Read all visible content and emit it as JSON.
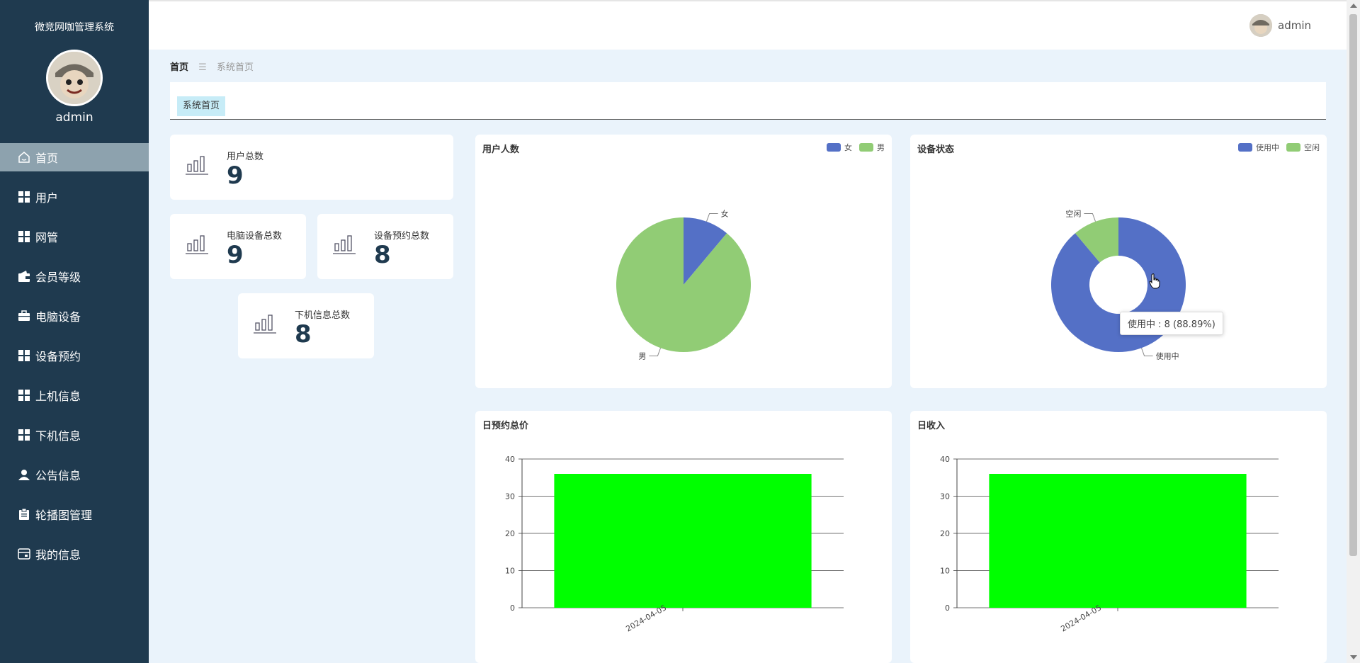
{
  "app": {
    "title": "微竞网咖管理系统",
    "username": "admin"
  },
  "sidebar": {
    "items": [
      {
        "label": "首页",
        "icon": "home-icon"
      },
      {
        "label": "用户",
        "icon": "grid-icon"
      },
      {
        "label": "网管",
        "icon": "grid-icon"
      },
      {
        "label": "会员等级",
        "icon": "wallet-icon"
      },
      {
        "label": "电脑设备",
        "icon": "briefcase-icon"
      },
      {
        "label": "设备预约",
        "icon": "grid-icon"
      },
      {
        "label": "上机信息",
        "icon": "grid-icon"
      },
      {
        "label": "下机信息",
        "icon": "grid-icon"
      },
      {
        "label": "公告信息",
        "icon": "person-icon"
      },
      {
        "label": "轮播图管理",
        "icon": "clipboard-icon"
      },
      {
        "label": "我的信息",
        "icon": "card-icon"
      }
    ]
  },
  "breadcrumb": {
    "home": "首页",
    "separator": "☰",
    "current": "系统首页"
  },
  "tabs": [
    {
      "label": "系统首页"
    }
  ],
  "stats": {
    "users": {
      "label": "用户总数",
      "value": "9"
    },
    "computers": {
      "label": "电脑设备总数",
      "value": "9"
    },
    "reservations": {
      "label": "设备预约总数",
      "value": "8"
    },
    "logouts": {
      "label": "下机信息总数",
      "value": "8"
    }
  },
  "colors": {
    "blue": "#5470c6",
    "green": "#91cc75",
    "bar": "#00ff00",
    "sidebar": "#1f3a4f"
  },
  "chart_data": [
    {
      "type": "pie",
      "title": "用户人数",
      "slices": [
        {
          "name": "女",
          "value": 1
        },
        {
          "name": "男",
          "value": 8
        }
      ]
    },
    {
      "type": "pie",
      "variant": "donut",
      "title": "设备状态",
      "slices": [
        {
          "name": "使用中",
          "value": 8
        },
        {
          "name": "空闲",
          "value": 1
        }
      ],
      "tooltip": "使用中 : 8 (88.89%)"
    },
    {
      "type": "bar",
      "title": "日预约总价",
      "categories": [
        "2024-04-05"
      ],
      "values": [
        36
      ],
      "ylim": [
        0,
        40
      ],
      "yticks": [
        0,
        10,
        20,
        30,
        40
      ]
    },
    {
      "type": "bar",
      "title": "日收入",
      "categories": [
        "2024-04-05"
      ],
      "values": [
        36
      ],
      "ylim": [
        0,
        40
      ],
      "yticks": [
        0,
        10,
        20,
        30,
        40
      ]
    }
  ]
}
